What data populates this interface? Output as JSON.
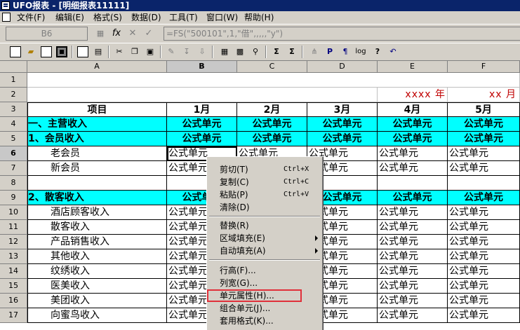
{
  "window": {
    "title": "UFO报表 - [明细报表11111]"
  },
  "menu": [
    "文件(F)",
    "编辑(E)",
    "格式(S)",
    "数据(D)",
    "工具(T)",
    "窗口(W)",
    "帮助(H)"
  ],
  "formula_bar": {
    "cell_ref": "B6",
    "formula": "=FS(\"500101\",1,\"借\",,,,,\"y\")"
  },
  "columns": [
    "A",
    "B",
    "C",
    "D",
    "E",
    "F"
  ],
  "rows": [
    "1",
    "2",
    "3",
    "4",
    "5",
    "6",
    "7",
    "8",
    "9",
    "10",
    "11",
    "12",
    "13",
    "14",
    "15",
    "16",
    "17"
  ],
  "selected": {
    "column": "B",
    "row": "6"
  },
  "sheet": {
    "row2": {
      "e": "xxxx 年",
      "f": "xx 月"
    },
    "header": [
      "项目",
      "1月",
      "2月",
      "3月",
      "4月",
      "5月"
    ],
    "formula_cell": "公式单元",
    "items": {
      "r4": "一、主营收入",
      "r5": "1、会员收入",
      "r6": "老会员",
      "r7": "新会员",
      "r9": "2、散客收入",
      "r10": "酒店顾客收入",
      "r11": "散客收入",
      "r12": "产品销售收入",
      "r13": "其他收入",
      "r14": "纹绣收入",
      "r15": "医美收入",
      "r16": "美团收入",
      "r17": "向蜜鸟收入"
    }
  },
  "context_menu": {
    "cut": {
      "label": "剪切(T)",
      "shortcut": "Ctrl+X"
    },
    "copy": {
      "label": "复制(C)",
      "shortcut": "Ctrl+C"
    },
    "paste": {
      "label": "粘贴(P)",
      "shortcut": "Ctrl+V"
    },
    "clear": {
      "label": "清除(D)"
    },
    "replace": {
      "label": "替换(R)"
    },
    "area_fill": {
      "label": "区域填充(E)"
    },
    "auto_fill": {
      "label": "自动填充(A)"
    },
    "row_height": {
      "label": "行高(F)..."
    },
    "col_width": {
      "label": "列宽(G)..."
    },
    "cell_props": {
      "label": "单元属性(H)..."
    },
    "merge": {
      "label": "组合单元(J)..."
    },
    "style": {
      "label": "套用格式(K)..."
    }
  },
  "colors": {
    "title_bg": "#0a246a",
    "cyan_fill": "#00ffff",
    "highlight_box": "#e0303a",
    "period_text": "#c00000"
  }
}
